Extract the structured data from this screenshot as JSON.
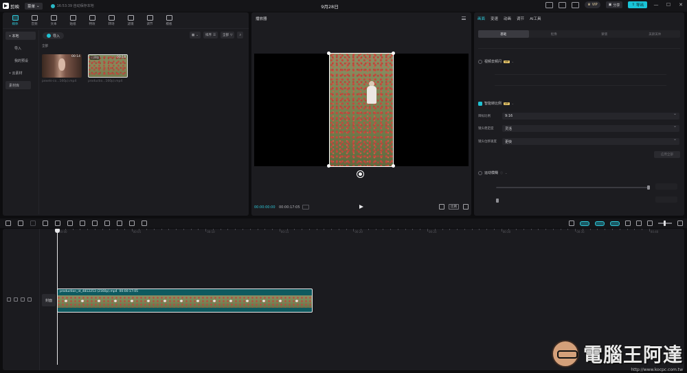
{
  "titlebar": {
    "app_name": "剪映",
    "menu_label": "菜单",
    "save_status": "16:53:39 自动保存本地",
    "project_title": "9月28日",
    "vip_label": "VIP",
    "share_label": "分享",
    "export_label": "导出",
    "win_min": "—",
    "win_max": "☐",
    "win_close": "✕"
  },
  "media": {
    "tabs": [
      {
        "label": "媒体",
        "icon": "media-icon"
      },
      {
        "label": "音频",
        "icon": "audio-icon"
      },
      {
        "label": "文本",
        "icon": "text-icon"
      },
      {
        "label": "贴纸",
        "icon": "sticker-icon"
      },
      {
        "label": "特效",
        "icon": "effects-icon"
      },
      {
        "label": "转场",
        "icon": "transition-icon"
      },
      {
        "label": "滤镜",
        "icon": "filter-icon"
      },
      {
        "label": "调节",
        "icon": "adjust-icon"
      },
      {
        "label": "模板",
        "icon": "template-icon"
      }
    ],
    "side": {
      "local": "• 本地",
      "import": "导入",
      "my_presets": "我的预设",
      "cloud": "• 云素材",
      "library": "素材库"
    },
    "import_btn": "导入",
    "sort_label": "排序",
    "all_filter": "全部",
    "section_label": "全部",
    "items": [
      {
        "name": "pexels-co...160p).mp4",
        "duration": "00:14"
      },
      {
        "name": "productio...160p).mp4",
        "duration": "00:18",
        "badge": "已添加"
      }
    ]
  },
  "player": {
    "title": "播放器",
    "time_current": "00:00:00:00",
    "time_total": "00:00:17:05",
    "ratio_label": "比例"
  },
  "props": {
    "tabs": [
      "画面",
      "变速",
      "动画",
      "调节",
      "AI工具"
    ],
    "segments": [
      "基础",
      "抠像",
      "蒙版",
      "美颜美体"
    ],
    "video_denoise": "视频去频闪",
    "smart_ratio": "智能转比例",
    "vip_tag": "VIP",
    "target_ratio_label": "目标比例",
    "target_ratio_value": "9:16",
    "stabilize_label": "镜头稳定度",
    "stabilize_value": "灵活",
    "speed_label": "镜头位移速度",
    "speed_value": "更快",
    "apply_label": "应用全部",
    "motion_blur": "运动模糊"
  },
  "timeline": {
    "cover_label": "封面",
    "ruler": [
      "00:00",
      "00:05",
      "00:10",
      "00:15",
      "00:20",
      "00:25",
      "00:30",
      "00:35",
      "00:40"
    ],
    "clip_label": "production_id_4812253 (2160p).mp4",
    "clip_duration": "00:00:17:05"
  },
  "watermark": {
    "text": "電腦王阿達",
    "url": "http://www.kocpc.com.tw"
  },
  "colors": {
    "accent": "#2ec7d8",
    "export": "#19c3d6",
    "clip": "#0e5a5f",
    "background": "#0d0d0f",
    "panel": "#1c1c20"
  }
}
